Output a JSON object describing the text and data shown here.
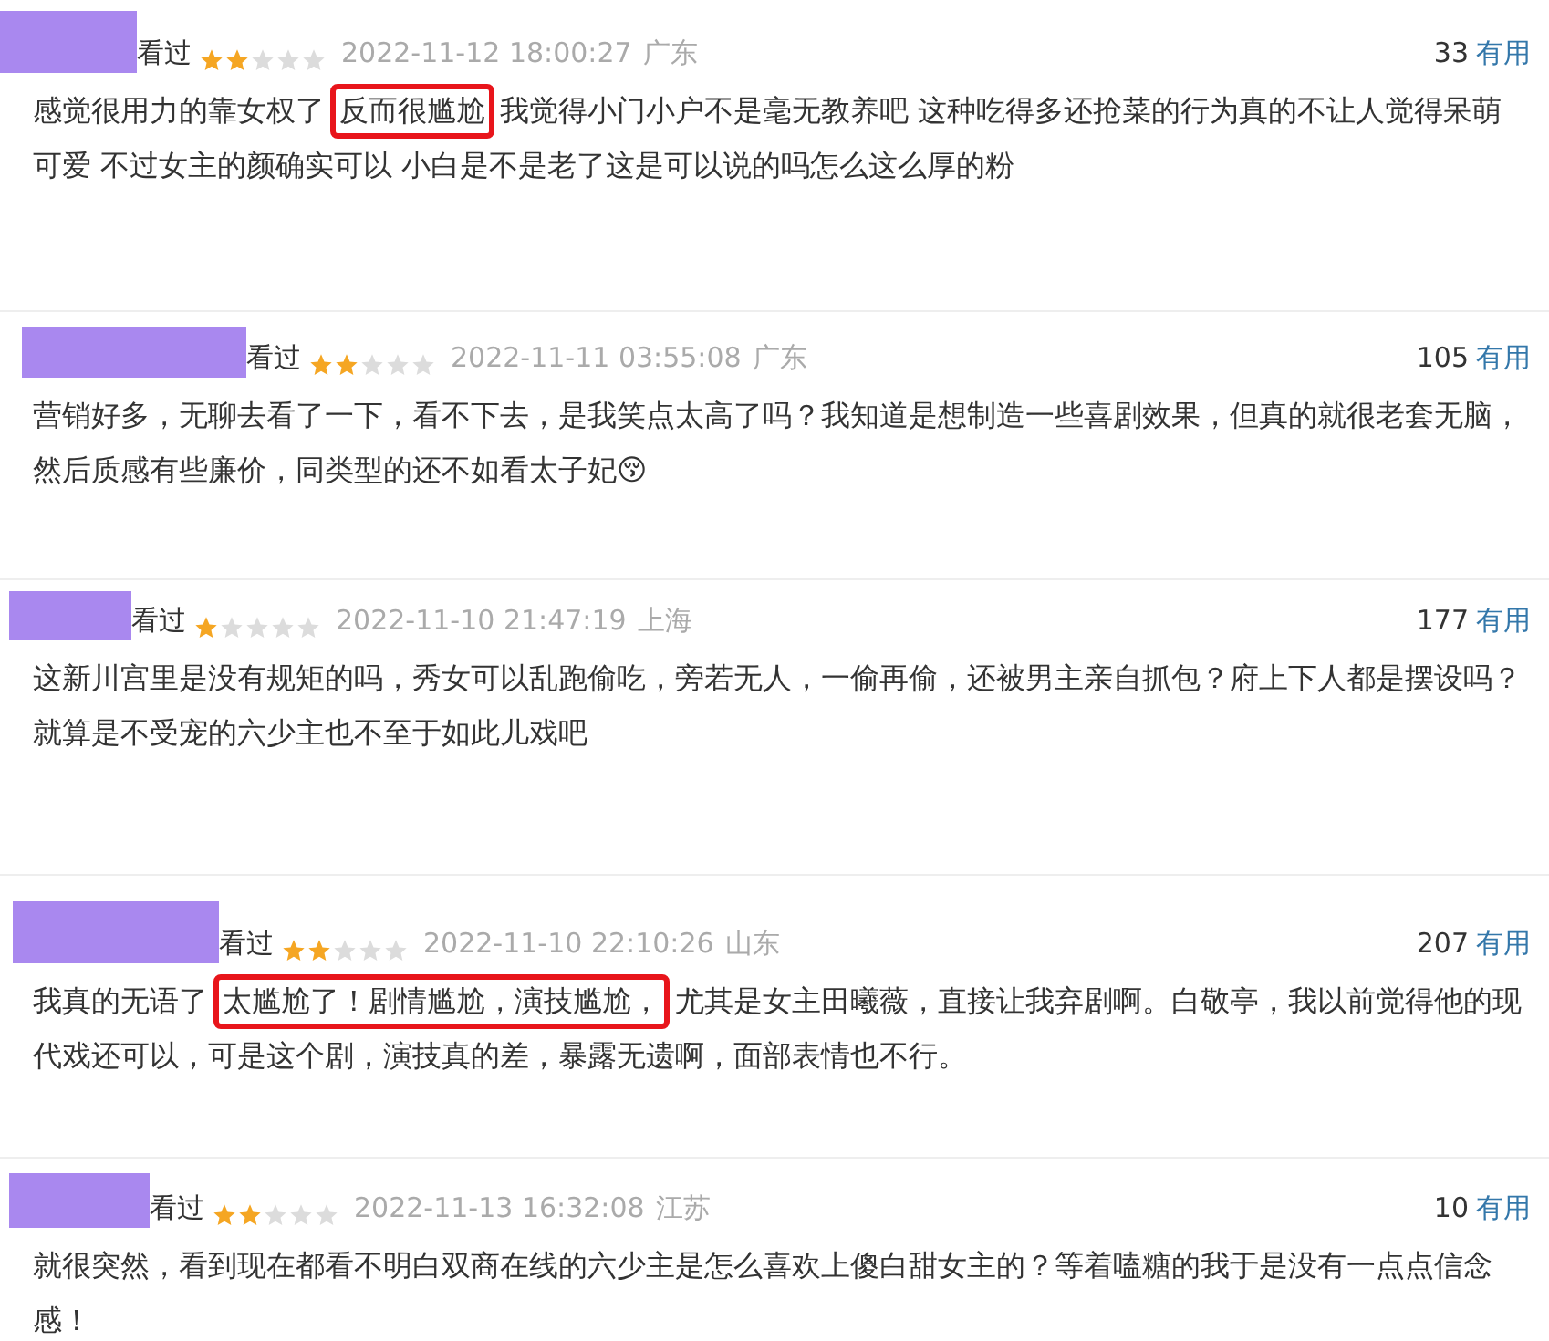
{
  "reviews": [
    {
      "status": "看过",
      "stars": 2,
      "time": "2022-11-12 18:00:27",
      "location": "广东",
      "votes": "33",
      "vote_label": "有用",
      "segments": [
        {
          "text": "感觉很用力的靠女权了",
          "highlighted": false
        },
        {
          "text": "反而很尴尬",
          "highlighted": true
        },
        {
          "text": "我觉得小门小户不是毫无教养吧 这种吃得多还抢菜的行为真的不让人觉得呆萌可爱 不过女主的颜确实可以 小白是不是老了这是可以说的吗怎么这么厚的粉",
          "highlighted": false
        }
      ]
    },
    {
      "status": "看过",
      "stars": 2,
      "time": "2022-11-11 03:55:08",
      "location": "广东",
      "votes": "105",
      "vote_label": "有用",
      "segments": [
        {
          "text": "营销好多，无聊去看了一下，看不下去，是我笑点太高了吗？我知道是想制造一些喜剧效果，但真的就很老套无脑，然后质感有些廉价，同类型的还不如看太子妃😚",
          "highlighted": false
        }
      ]
    },
    {
      "status": "看过",
      "stars": 1,
      "time": "2022-11-10 21:47:19",
      "location": "上海",
      "votes": "177",
      "vote_label": "有用",
      "segments": [
        {
          "text": "这新川宫里是没有规矩的吗，秀女可以乱跑偷吃，旁若无人，一偷再偷，还被男主亲自抓包？府上下人都是摆设吗？就算是不受宠的六少主也不至于如此儿戏吧",
          "highlighted": false
        }
      ]
    },
    {
      "status": "看过",
      "stars": 2,
      "time": "2022-11-10 22:10:26",
      "location": "山东",
      "votes": "207",
      "vote_label": "有用",
      "segments": [
        {
          "text": "我真的无语了",
          "highlighted": false
        },
        {
          "text": "太尴尬了！剧情尴尬，演技尴尬，",
          "highlighted": true
        },
        {
          "text": "尤其是女主田曦薇，直接让我弃剧啊。白敬亭，我以前觉得他的现代戏还可以，可是这个剧，演技真的差，暴露无遗啊，面部表情也不行。",
          "highlighted": false
        }
      ]
    },
    {
      "status": "看过",
      "stars": 2,
      "time": "2022-11-13 16:32:08",
      "location": "江苏",
      "votes": "10",
      "vote_label": "有用",
      "segments": [
        {
          "text": "就很突然，看到现在都看不明白双商在线的六少主是怎么喜欢上傻白甜女主的？等着嗑糖的我于是没有一点点信念感！",
          "highlighted": false
        }
      ]
    }
  ]
}
